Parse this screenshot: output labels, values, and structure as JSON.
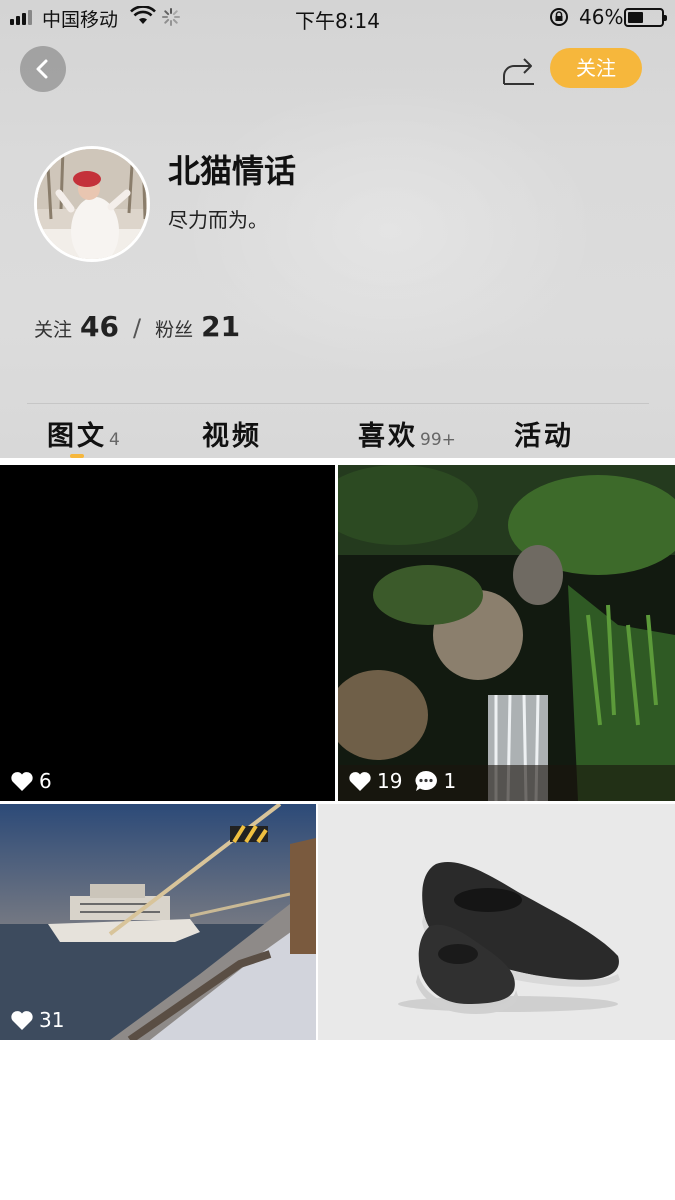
{
  "status_bar": {
    "carrier": "中国移动",
    "time": "下午8:14",
    "battery_percent": "46%",
    "battery_level": 0.46
  },
  "nav": {
    "follow_label": "关注"
  },
  "profile": {
    "name": "北猫情话",
    "bio": "尽力而为。",
    "following_label": "关注",
    "following_count": "46",
    "separator": "/",
    "followers_label": "粉丝",
    "followers_count": "21"
  },
  "tabs": [
    {
      "label": "图文",
      "count": "4"
    },
    {
      "label": "视频",
      "count": ""
    },
    {
      "label": "喜欢",
      "count": "99+"
    },
    {
      "label": "活动",
      "count": ""
    }
  ],
  "posts": [
    {
      "likes": "6",
      "comments": ""
    },
    {
      "likes": "19",
      "comments": "1"
    },
    {
      "likes": "31",
      "comments": ""
    },
    {
      "likes": "",
      "comments": ""
    }
  ],
  "colors": {
    "accent": "#f6b73c",
    "header_bg": "#d9d9d9"
  },
  "icons": {
    "back": "chevron-left-icon",
    "share": "share-icon",
    "like": "heart-icon",
    "comment": "comment-icon"
  }
}
